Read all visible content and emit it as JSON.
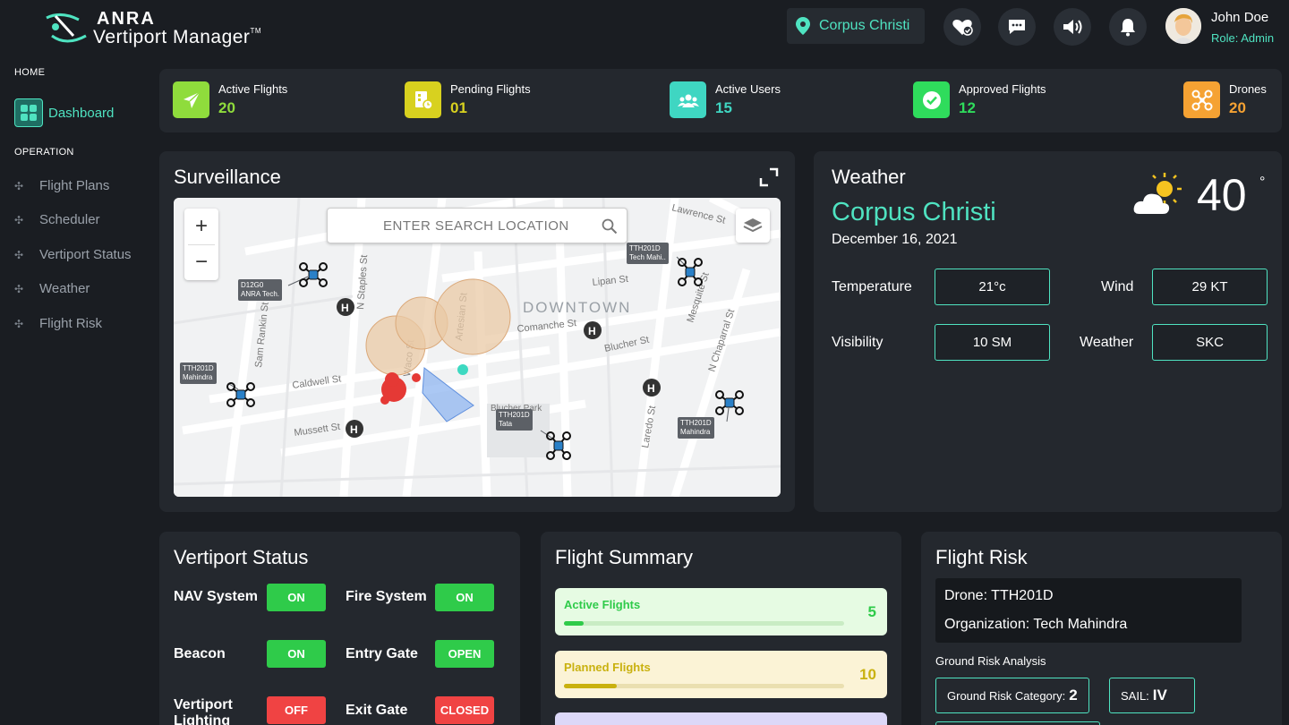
{
  "app": {
    "logo_top": "ANRA",
    "logo_bottom": "Vertiport Manager",
    "trademark": "TM"
  },
  "header": {
    "location": "Corpus Christi",
    "user_name": "John Doe",
    "user_role": "Role: Admin",
    "icons": [
      "heart-check-icon",
      "chat-icon",
      "speaker-icon",
      "bell-icon"
    ]
  },
  "sidebar": {
    "home_heading": "HOME",
    "dashboard_label": "Dashboard",
    "operation_heading": "OPERATION",
    "items": [
      {
        "label": "Flight Plans"
      },
      {
        "label": "Scheduler"
      },
      {
        "label": "Vertiport Status"
      },
      {
        "label": "Weather"
      },
      {
        "label": "Flight Risk"
      }
    ]
  },
  "stats": [
    {
      "label": "Active Flights",
      "value": "20",
      "color": "#8fdc3c",
      "icon": "paper-plane-icon"
    },
    {
      "label": "Pending Flights",
      "value": "01",
      "color": "#d8d11f",
      "icon": "clipboard-clock-icon"
    },
    {
      "label": "Active Users",
      "value": "15",
      "color": "#3fd6c2",
      "icon": "users-icon"
    },
    {
      "label": "Approved Flights",
      "value": "12",
      "color": "#2fdc5c",
      "icon": "check-badge-icon"
    },
    {
      "label": "Drones",
      "value": "20",
      "color": "#f5a233",
      "icon": "drone-icon"
    }
  ],
  "surveillance": {
    "title": "Surveillance",
    "search_placeholder": "ENTER SEARCH LOCATION",
    "area_label": "DOWNTOWN",
    "streets": [
      "N Staples St",
      "Sam Rankin St",
      "Caldwell St",
      "Mussett St",
      "Lipan St",
      "Comanche St",
      "Blucher St",
      "Waco St",
      "Artesian St",
      "Mesquite St",
      "N Chaparral St",
      "Laredo St",
      "Lawrence St",
      "Blucher Park"
    ],
    "tags": [
      {
        "line1": "D12G0",
        "line2": "ANRA Tech."
      },
      {
        "line1": "TTH201D",
        "line2": "Mahindra"
      },
      {
        "line1": "TTH201D",
        "line2": "Tech Mahi.."
      },
      {
        "line1": "TTH201D",
        "line2": "Tata"
      },
      {
        "line1": "TTH201D",
        "line2": "Mahindra"
      }
    ]
  },
  "weather": {
    "title": "Weather",
    "city": "Corpus Christi",
    "date": "December 16, 2021",
    "temp": "40",
    "deg": "°",
    "fields": [
      {
        "label": "Temperature",
        "value": "21°c"
      },
      {
        "label": "Wind",
        "value": "29 KT"
      },
      {
        "label": "Visibility",
        "value": "10 SM"
      },
      {
        "label": "Weather",
        "value": "SKC"
      }
    ]
  },
  "vertiport": {
    "title": "Vertiport Status",
    "items": [
      {
        "label": "NAV System",
        "status": "ON",
        "color": "#2fcb4a"
      },
      {
        "label": "Fire System",
        "status": "ON",
        "color": "#2fcb4a"
      },
      {
        "label": "Beacon",
        "status": "ON",
        "color": "#2fcb4a"
      },
      {
        "label": "Entry Gate",
        "status": "OPEN",
        "color": "#2fcb4a"
      },
      {
        "label": "Vertiport Lighting",
        "status": "OFF",
        "color": "#f04343"
      },
      {
        "label": "Exit Gate",
        "status": "CLOSED",
        "color": "#f04343"
      }
    ]
  },
  "flight_summary": {
    "title": "Flight Summary",
    "cards": [
      {
        "label": "Active Flights",
        "count": "5",
        "progress": 0.07,
        "bg": "#e6fbe3",
        "fg": "#2fcb4a",
        "track": "#c9ecc4"
      },
      {
        "label": "Planned Flights",
        "count": "10",
        "progress": 0.19,
        "bg": "#fbf3d6",
        "fg": "#c9b10f",
        "track": "#eadfb0"
      }
    ]
  },
  "flight_risk": {
    "title": "Flight Risk",
    "drone": "Drone: TTH201D",
    "organization": "Organization: Tech Mahindra",
    "sub": "Ground Risk Analysis",
    "grc_label": "Ground Risk Category:",
    "grc_value": "2",
    "sail_label": "SAIL:",
    "sail_value": "IV"
  }
}
